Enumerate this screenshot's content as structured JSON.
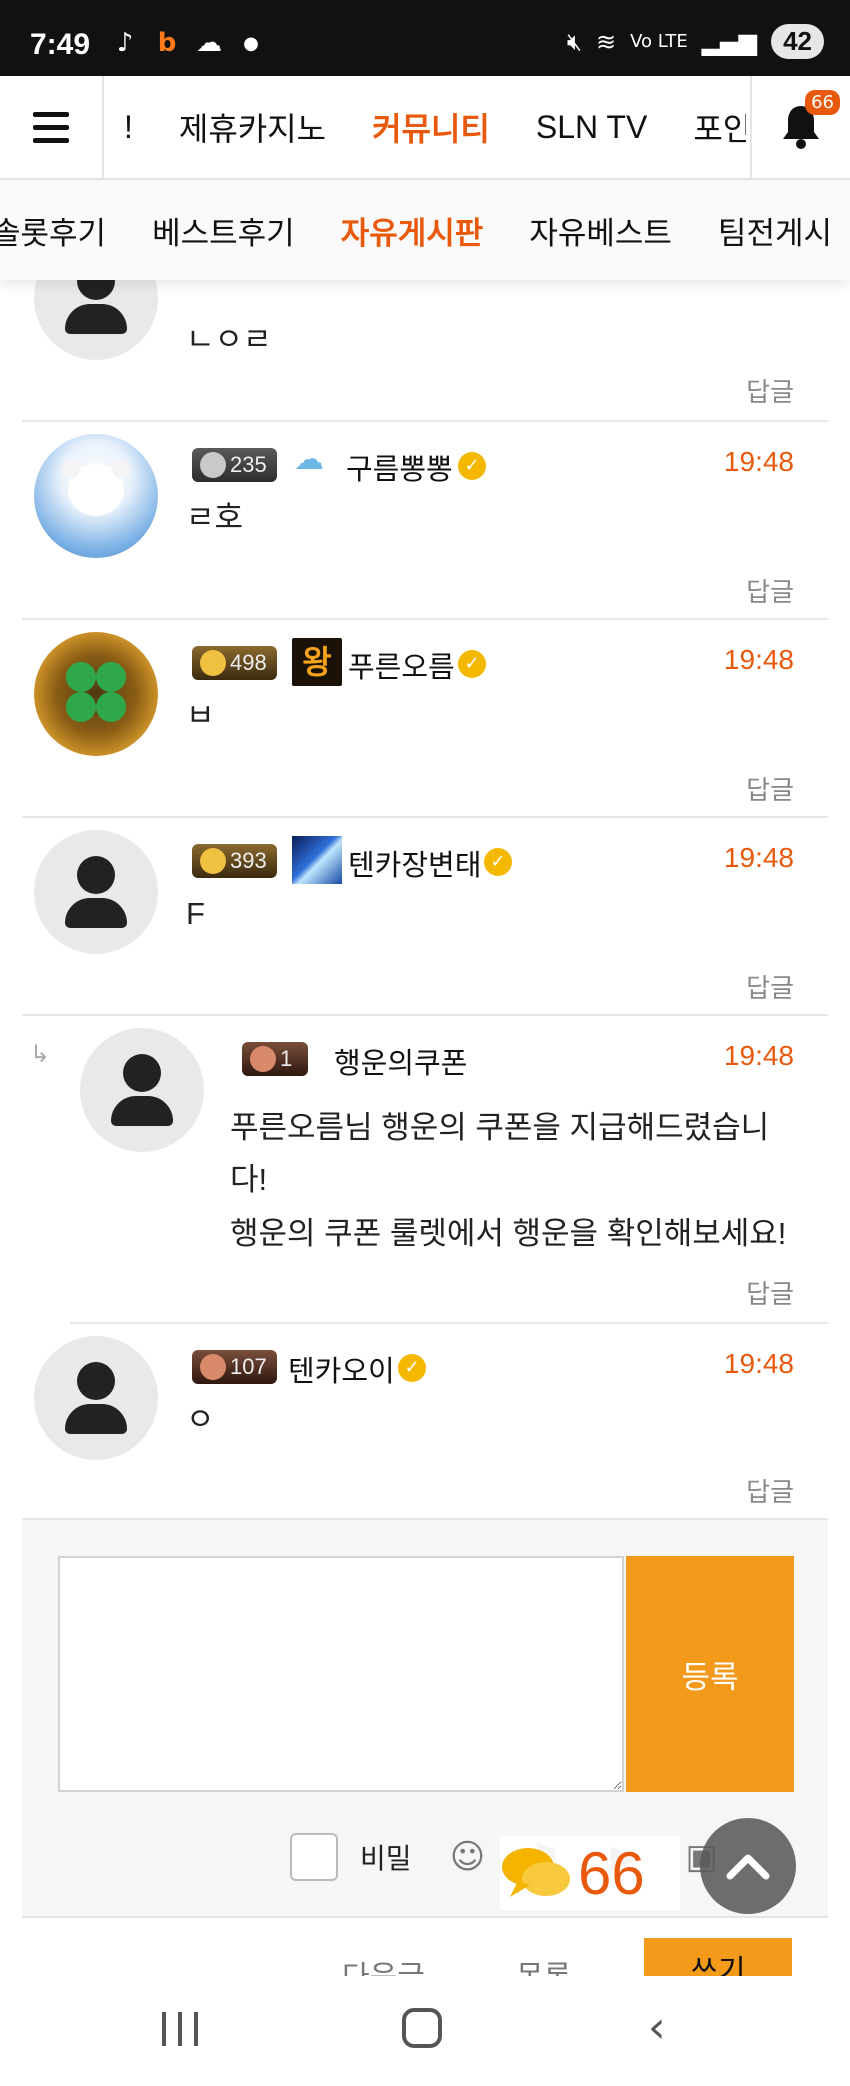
{
  "status_bar": {
    "time": "7:49",
    "battery": "42",
    "carrier": "Vo LTE"
  },
  "top_nav": {
    "items": [
      "!",
      "제휴카지노",
      "커뮤니티",
      "SLN TV",
      "포인"
    ],
    "active_index": 2,
    "notification_count": "66"
  },
  "sub_nav": {
    "items": [
      "솔롯후기",
      "베스트후기",
      "자유게시판",
      "자유베스트",
      "팀전게시"
    ],
    "active_index": 2
  },
  "comments": [
    {
      "text": "ㄴㅇㄹ",
      "reply": "답글"
    },
    {
      "level": "235",
      "nick": "구름뽕뽕",
      "time": "19:48",
      "text": "ㄹ호",
      "reply": "답글"
    },
    {
      "level": "498",
      "badge": "왕",
      "nick": "푸른오름",
      "time": "19:48",
      "text": "ㅂ",
      "reply": "답글"
    },
    {
      "level": "393",
      "nick": "텐카장변태",
      "time": "19:48",
      "text": "F",
      "reply": "답글"
    },
    {
      "level": "1",
      "nick": "행운의쿠폰",
      "time": "19:48",
      "text_line1": "푸른오름님 행운의 쿠폰을 지급해드렸습니",
      "text_line2": "다!",
      "text_line3": "행운의 쿠폰 룰렛에서 행운을 확인해보세요!",
      "reply": "답글"
    },
    {
      "level": "107",
      "nick": "텐카오이",
      "time": "19:48",
      "text": "ㅇ",
      "reply": "답글"
    }
  ],
  "write_box": {
    "submit_label": "등록",
    "secret_label": "비밀"
  },
  "floating": {
    "chat_count": "66"
  },
  "bottom_actions": {
    "next_label": "다음글",
    "list_label": "목록",
    "write_label": "쓰기"
  },
  "colors": {
    "accent": "#e8590c",
    "button": "#f39a1a",
    "verified": "#f5b800"
  }
}
